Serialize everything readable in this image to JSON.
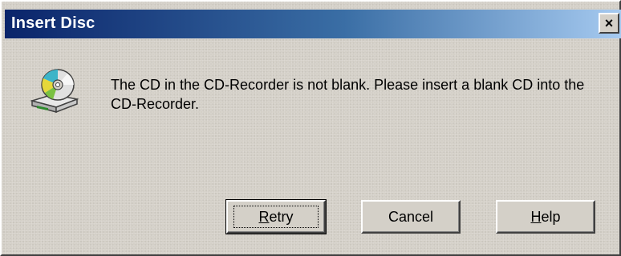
{
  "window": {
    "title": "Insert Disc",
    "close_label": "×"
  },
  "icon": {
    "name": "cd-drive-icon"
  },
  "message": {
    "text": "The CD in the CD-Recorder is not blank. Please insert a blank CD into the CD-Recorder."
  },
  "buttons": {
    "retry": {
      "accel": "R",
      "rest": "etry"
    },
    "cancel": {
      "label": "Cancel"
    },
    "help": {
      "accel": "H",
      "rest": "elp"
    }
  },
  "colors": {
    "dialog_face": "#d4d0c8",
    "titlebar_start": "#0a246a",
    "titlebar_end": "#a6caf0",
    "title_text": "#ffffff"
  }
}
